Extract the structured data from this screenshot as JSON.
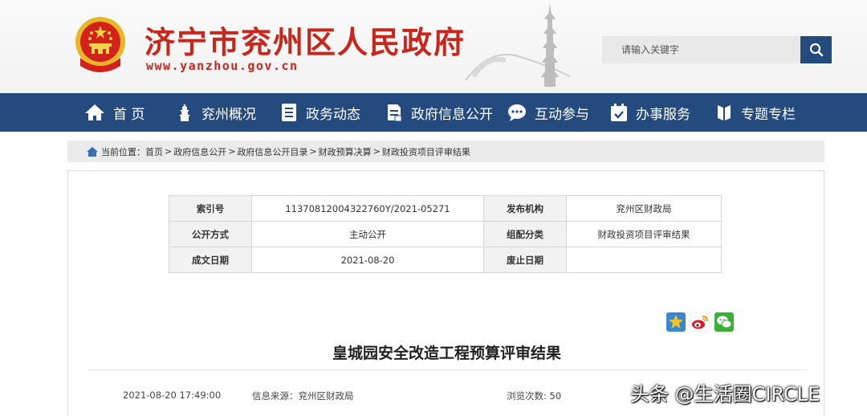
{
  "header": {
    "site_title": "济宁市兖州区人民政府",
    "site_url": "www.yanzhou.gov.cn",
    "search_placeholder": "请输入关键字"
  },
  "nav": [
    {
      "label": "首 页",
      "icon": "home-icon"
    },
    {
      "label": "兖州概况",
      "icon": "pagoda-icon"
    },
    {
      "label": "政务动态",
      "icon": "document-list-icon"
    },
    {
      "label": "政府信息公开",
      "icon": "info-open-icon"
    },
    {
      "label": "互动参与",
      "icon": "chat-icon"
    },
    {
      "label": "办事服务",
      "icon": "calendar-check-icon"
    },
    {
      "label": "专题专栏",
      "icon": "book-icon"
    }
  ],
  "breadcrumb": {
    "prefix": "当前位置：",
    "items": [
      "首页",
      "政府信息公开",
      "政府信息公开目录",
      "财政预算决算",
      "财政投资项目评审结果"
    ],
    "separator": ">"
  },
  "meta_table": {
    "rows": [
      {
        "k1": "索引号",
        "v1": "11370812004322760Y/2021-05271",
        "k2": "发布机构",
        "v2": "兖州区财政局"
      },
      {
        "k1": "公开方式",
        "v1": "主动公开",
        "k2": "组配分类",
        "v2": "财政投资项目评审结果"
      },
      {
        "k1": "成文日期",
        "v1": "2021-08-20",
        "k2": "废止日期",
        "v2": ""
      }
    ]
  },
  "share_icons": [
    "qzone-star-icon",
    "weibo-icon",
    "wechat-icon"
  ],
  "article": {
    "title": "皇城园安全改造工程预算评审结果",
    "datetime": "2021-08-20 17:49:00",
    "source": "信息来源：兖州区财政局",
    "views": "浏览次数: 50"
  },
  "watermark": "头条 @生活圈CIRCLE",
  "colors": {
    "brand_red": "#c9261c",
    "nav_blue": "#254a7e"
  }
}
